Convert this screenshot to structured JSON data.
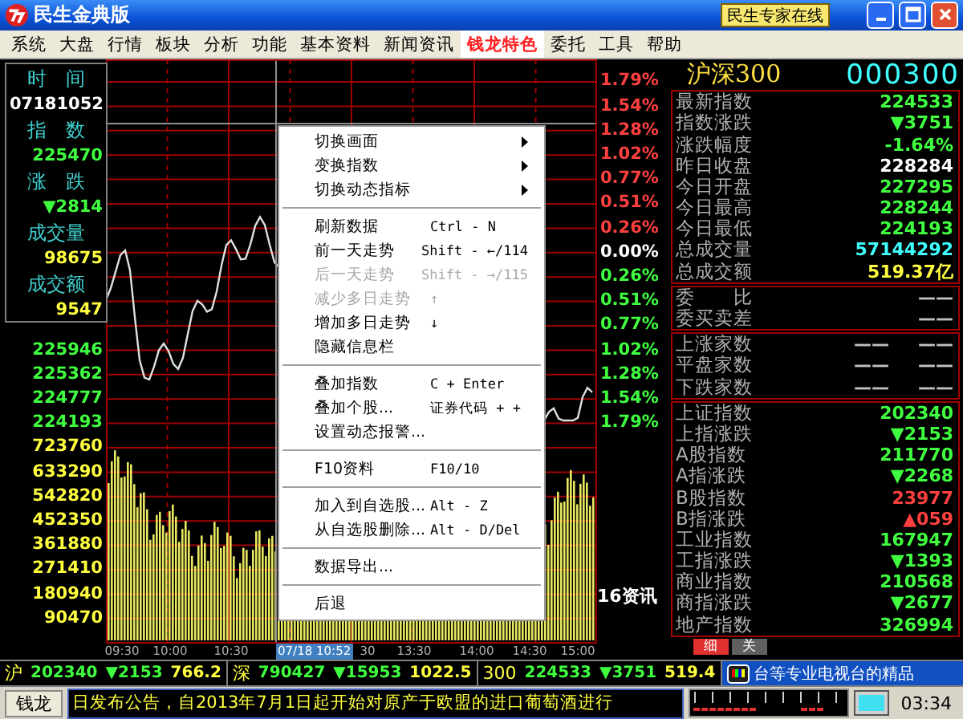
{
  "window": {
    "title": "民生金典版",
    "expert_button": "民生专家在线"
  },
  "menu": [
    {
      "label": "系统",
      "selected": false
    },
    {
      "label": "大盘",
      "selected": false
    },
    {
      "label": "行情",
      "selected": false
    },
    {
      "label": "板块",
      "selected": false
    },
    {
      "label": "分析",
      "selected": false
    },
    {
      "label": "功能",
      "selected": false
    },
    {
      "label": "基本资料",
      "selected": false
    },
    {
      "label": "新闻资讯",
      "selected": false
    },
    {
      "label": "钱龙特色",
      "selected": true
    },
    {
      "label": "委托",
      "selected": false
    },
    {
      "label": "工具",
      "selected": false
    },
    {
      "label": "帮助",
      "selected": false
    }
  ],
  "info_box": [
    {
      "label": "时　间",
      "value": "07181052",
      "color": "#ffffff"
    },
    {
      "label": "指　数",
      "value": "225470",
      "color": "#40ff40"
    },
    {
      "label": "涨　跌",
      "value": "▼2814",
      "color": "#40ff40"
    },
    {
      "label": "成交量",
      "value": "98675",
      "color": "#ffff40"
    },
    {
      "label": "成交额",
      "value": "9547",
      "color": "#ffff40"
    }
  ],
  "chart": {
    "price_labels": [
      "225946",
      "225362",
      "224777",
      "224193"
    ],
    "volume_labels": [
      "723760",
      "633290",
      "542820",
      "452350",
      "361880",
      "271410",
      "180940",
      "90470"
    ],
    "percent_labels": [
      {
        "text": "1.79%",
        "color": "#ff4040"
      },
      {
        "text": "1.54%",
        "color": "#ff4040"
      },
      {
        "text": "1.28%",
        "color": "#ff4040"
      },
      {
        "text": "1.02%",
        "color": "#ff4040"
      },
      {
        "text": "0.77%",
        "color": "#ff4040"
      },
      {
        "text": "0.51%",
        "color": "#ff4040"
      },
      {
        "text": "0.26%",
        "color": "#ff4040"
      },
      {
        "text": "0.00%",
        "color": "#ffffff"
      },
      {
        "text": "0.26%",
        "color": "#40ff40"
      },
      {
        "text": "0.51%",
        "color": "#40ff40"
      },
      {
        "text": "0.77%",
        "color": "#40ff40"
      },
      {
        "text": "1.02%",
        "color": "#40ff40"
      },
      {
        "text": "1.28%",
        "color": "#40ff40"
      },
      {
        "text": "1.54%",
        "color": "#40ff40"
      },
      {
        "text": "1.79%",
        "color": "#40ff40"
      }
    ],
    "time_labels": [
      "09:30",
      "10:00",
      "10:30",
      "30",
      "13:30",
      "14:00",
      "14:30",
      "15:00"
    ],
    "cursor_label": "07/18 10:52",
    "side_note": "16资讯"
  },
  "context_menu": {
    "sections": [
      [
        {
          "label": "切换画面",
          "submenu": true,
          "disabled": false
        },
        {
          "label": "变换指数",
          "submenu": true,
          "disabled": false
        },
        {
          "label": "切换动态指标",
          "submenu": true,
          "disabled": false
        }
      ],
      [
        {
          "label": "刷新数据",
          "shortcut": "Ctrl - N",
          "submenu": false,
          "disabled": false
        },
        {
          "label": "前一天走势",
          "shortcut": "Shift - ←/114",
          "submenu": false,
          "disabled": false
        },
        {
          "label": "后一天走势",
          "shortcut": "Shift - →/115",
          "submenu": false,
          "disabled": true
        },
        {
          "label": "减少多日走势",
          "shortcut": "↑",
          "submenu": false,
          "disabled": true
        },
        {
          "label": "增加多日走势",
          "shortcut": "↓",
          "submenu": false,
          "disabled": false
        },
        {
          "label": "隐藏信息栏",
          "submenu": false,
          "disabled": false
        }
      ],
      [
        {
          "label": "叠加指数",
          "shortcut": "C + Enter",
          "submenu": false,
          "disabled": false
        },
        {
          "label": "叠加个股...",
          "shortcut": "证券代码 + +",
          "submenu": false,
          "disabled": false
        },
        {
          "label": "设置动态报警...",
          "submenu": false,
          "disabled": false
        }
      ],
      [
        {
          "label": "F10资料",
          "shortcut": "F10/10",
          "submenu": false,
          "disabled": false
        }
      ],
      [
        {
          "label": "加入到自选股...",
          "shortcut": "Alt - Z",
          "submenu": false,
          "disabled": false
        },
        {
          "label": "从自选股删除...",
          "shortcut": "Alt - D/Del",
          "submenu": false,
          "disabled": false
        }
      ],
      [
        {
          "label": "数据导出...",
          "submenu": false,
          "disabled": false
        }
      ],
      [
        {
          "label": "后退",
          "submenu": false,
          "disabled": false
        }
      ]
    ]
  },
  "quote_panel": {
    "name": "沪深300",
    "code": "000300",
    "groups": [
      [
        {
          "label": "最新指数",
          "values": [
            {
              "text": "224533",
              "color": "#40ff40"
            }
          ]
        },
        {
          "label": "指数涨跌",
          "values": [
            {
              "text": "▼3751",
              "color": "#40ff40"
            }
          ]
        },
        {
          "label": "涨跌幅度",
          "values": [
            {
              "text": "-1.64%",
              "color": "#40ff40"
            }
          ]
        },
        {
          "label": "昨日收盘",
          "values": [
            {
              "text": "228284",
              "color": "#ffffff"
            }
          ]
        },
        {
          "label": "今日开盘",
          "values": [
            {
              "text": "227295",
              "color": "#40ff40"
            }
          ]
        },
        {
          "label": "今日最高",
          "values": [
            {
              "text": "228244",
              "color": "#40ff40"
            }
          ]
        },
        {
          "label": "今日最低",
          "values": [
            {
              "text": "224193",
              "color": "#40ff40"
            }
          ]
        },
        {
          "label": "总成交量",
          "values": [
            {
              "text": "57144292",
              "color": "#40ffff"
            }
          ]
        },
        {
          "label": "总成交额",
          "values": [
            {
              "text": "519.37亿",
              "color": "#ffff40"
            }
          ]
        }
      ],
      [
        {
          "label": "委　　比",
          "values": [
            {
              "text": "——",
              "color": "#c0c0c0"
            }
          ]
        },
        {
          "label": "委买卖差",
          "values": [
            {
              "text": "——",
              "color": "#c0c0c0"
            }
          ]
        }
      ],
      [
        {
          "label": "上涨家数",
          "values": [
            {
              "text": "——",
              "color": "#c0c0c0"
            },
            {
              "text": "——",
              "color": "#c0c0c0"
            }
          ]
        },
        {
          "label": "平盘家数",
          "values": [
            {
              "text": "——",
              "color": "#c0c0c0"
            },
            {
              "text": "——",
              "color": "#c0c0c0"
            }
          ]
        },
        {
          "label": "下跌家数",
          "values": [
            {
              "text": "——",
              "color": "#c0c0c0"
            },
            {
              "text": "——",
              "color": "#c0c0c0"
            }
          ]
        }
      ],
      [
        {
          "label": "上证指数",
          "values": [
            {
              "text": "202340",
              "color": "#40ff40"
            }
          ]
        },
        {
          "label": "上指涨跌",
          "values": [
            {
              "text": "▼2153",
              "color": "#40ff40"
            }
          ]
        },
        {
          "label": "A股指数",
          "values": [
            {
              "text": "211770",
              "color": "#40ff40"
            }
          ]
        },
        {
          "label": "A指涨跌",
          "values": [
            {
              "text": "▼2268",
              "color": "#40ff40"
            }
          ]
        },
        {
          "label": "B股指数",
          "values": [
            {
              "text": "23977",
              "color": "#ff4040"
            }
          ]
        },
        {
          "label": "B指涨跌",
          "values": [
            {
              "text": "▲059",
              "color": "#ff4040"
            }
          ]
        },
        {
          "label": "工业指数",
          "values": [
            {
              "text": "167947",
              "color": "#40ff40"
            }
          ]
        },
        {
          "label": "工指涨跌",
          "values": [
            {
              "text": "▼1393",
              "color": "#40ff40"
            }
          ]
        },
        {
          "label": "商业指数",
          "values": [
            {
              "text": "210568",
              "color": "#40ff40"
            }
          ]
        },
        {
          "label": "商指涨跌",
          "values": [
            {
              "text": "▼2677",
              "color": "#40ff40"
            }
          ]
        },
        {
          "label": "地产指数",
          "values": [
            {
              "text": "326994",
              "color": "#40ff40"
            }
          ]
        }
      ]
    ],
    "tabs": [
      {
        "label": "细",
        "selected": true
      },
      {
        "label": "关",
        "selected": false
      }
    ]
  },
  "ticker": {
    "markets": [
      {
        "label": "沪",
        "index": "202340",
        "change": "▼2153",
        "amount": "766.2"
      },
      {
        "label": "深",
        "index": "790427",
        "change": "▼15953",
        "amount": "1022.5"
      },
      {
        "label": "300",
        "index": "224533",
        "change": "▼3751",
        "amount": "519.4"
      }
    ],
    "tv_text": "台等专业电视台的精品"
  },
  "status_bar": {
    "button": "钱龙",
    "news": "日发布公告，自2013年7月1日起开始对原产于欧盟的进口葡萄酒进行",
    "time": "03:34"
  }
}
